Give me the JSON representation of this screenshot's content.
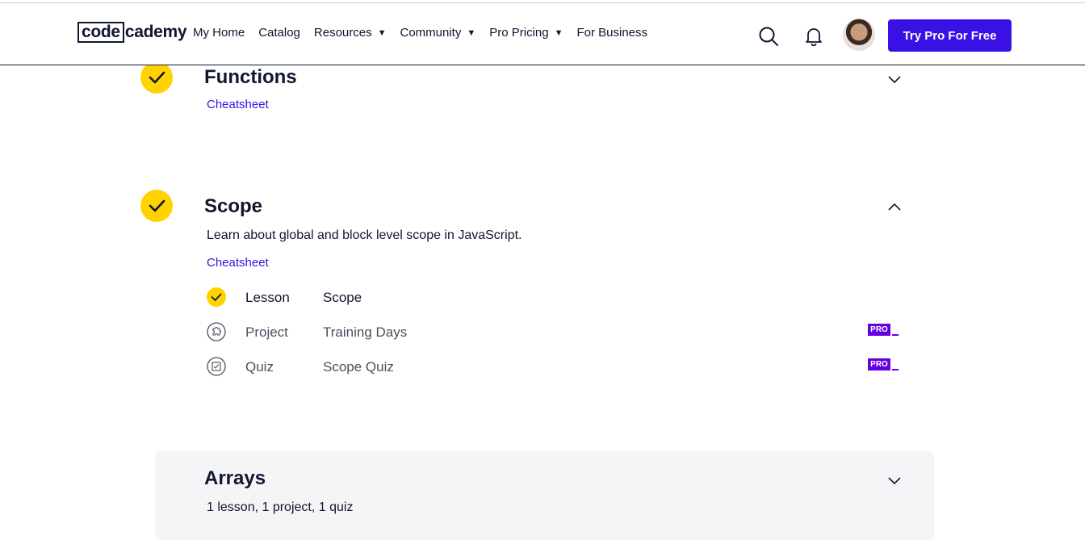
{
  "header": {
    "logo_code": "code",
    "logo_cademy": "cademy",
    "nav": [
      {
        "label": "My Home",
        "dropdown": false
      },
      {
        "label": "Catalog",
        "dropdown": false
      },
      {
        "label": "Resources",
        "dropdown": true
      },
      {
        "label": "Community",
        "dropdown": true
      },
      {
        "label": "Pro Pricing",
        "dropdown": true
      },
      {
        "label": "For Business",
        "dropdown": false
      }
    ],
    "caret": "▼",
    "cta": "Try Pro For Free"
  },
  "modules": {
    "functions": {
      "title": "Functions",
      "cheatsheet": "Cheatsheet",
      "state": "collapsed"
    },
    "scope": {
      "title": "Scope",
      "description": "Learn about global and block level scope in JavaScript.",
      "cheatsheet": "Cheatsheet",
      "state": "expanded",
      "items": [
        {
          "type": "Lesson",
          "name": "Scope",
          "icon": "check-icon",
          "done": true,
          "pro": false
        },
        {
          "type": "Project",
          "name": "Training Days",
          "icon": "puzzle-icon",
          "done": false,
          "pro": true
        },
        {
          "type": "Quiz",
          "name": "Scope Quiz",
          "icon": "quiz-icon",
          "done": false,
          "pro": true
        }
      ]
    },
    "arrays": {
      "title": "Arrays",
      "summary": "1 lesson, 1 project, 1 quiz",
      "state": "collapsed"
    }
  },
  "pro_label": "PRO",
  "colors": {
    "brand": "#3a10e5",
    "check": "#ffd300",
    "pro": "#6400e4",
    "text": "#10162f"
  }
}
